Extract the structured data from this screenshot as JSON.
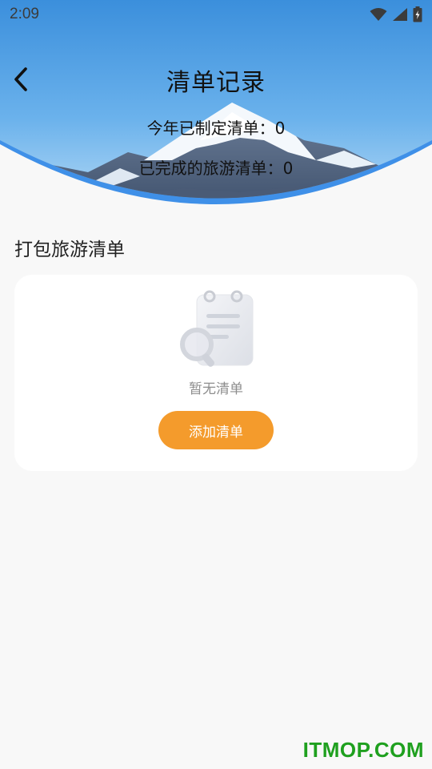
{
  "status_bar": {
    "time": "2:09",
    "icons": [
      "wifi-icon",
      "signal-icon",
      "battery-charging-icon"
    ]
  },
  "header": {
    "back_icon": "chevron-left-icon",
    "title": "清单记录",
    "stat_year_label": "今年已制定清单：",
    "stat_year_value": "0",
    "stat_done_label": "已完成的旅游清单：",
    "stat_done_value": "0"
  },
  "section": {
    "title": "打包旅游清单"
  },
  "empty_card": {
    "illustration_icon": "notepad-magnifier-icon",
    "empty_text": "暂无清单",
    "add_button_label": "添加清单"
  },
  "watermark": {
    "text": "ITMOP.COM"
  },
  "colors": {
    "accent_orange": "#f49b2c",
    "header_blue": "#3f90e8",
    "watermark_green": "#1fa01f"
  }
}
